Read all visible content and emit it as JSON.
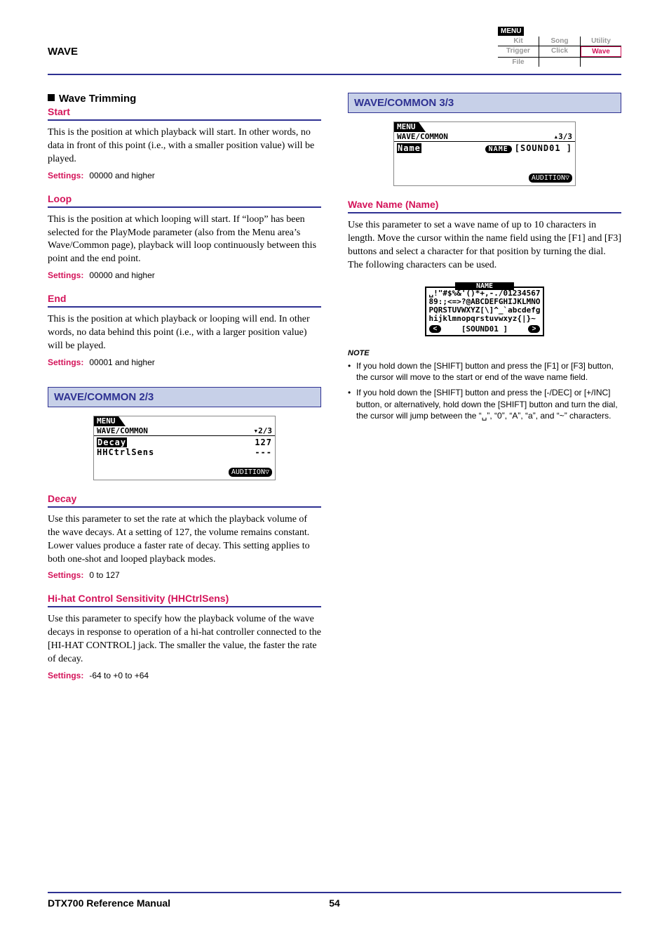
{
  "header": {
    "section": "WAVE",
    "menu_label": "MENU",
    "menu_cells": [
      [
        "Kit",
        "Song",
        "Utility"
      ],
      [
        "Trigger",
        "Click",
        "Wave"
      ],
      [
        "File",
        "",
        ""
      ]
    ],
    "active_cell": "Wave"
  },
  "left": {
    "trim_heading": "Wave Trimming",
    "start": {
      "title": "Start",
      "body": "This is the position at which playback will start. In other words, no data in front of this point (i.e., with a smaller position value) will be played.",
      "settings": "00000 and higher"
    },
    "loop": {
      "title": "Loop",
      "body": "This is the position at which looping will start. If “loop” has been selected for the PlayMode parameter (also from the Menu area’s Wave/Common page), playback will loop continuously between this point and the end point.",
      "settings": "00000 and higher"
    },
    "end": {
      "title": "End",
      "body": "This is the position at which playback or looping will end. In other words, no data behind this point (i.e., with a larger position value) will be played.",
      "settings": "00001 and higher"
    },
    "block23": "WAVE/COMMON 2/3",
    "lcd2": {
      "tab": "MENU",
      "path": "WAVE/COMMON",
      "page": "▾2/3",
      "rows": [
        [
          "Decay",
          "127"
        ],
        [
          "HHCtrlSens",
          "---"
        ]
      ],
      "audition": "AUDITION▽"
    },
    "decay": {
      "title": "Decay",
      "body": "Use this parameter to set the rate at which the playback volume of the wave decays. At a setting of 127, the volume remains constant. Lower values produce a faster rate of decay. This setting applies to both one-shot and looped playback modes.",
      "settings": "0 to 127"
    },
    "hhsens": {
      "title": "Hi-hat Control Sensitivity (HHCtrlSens)",
      "body": "Use this parameter to specify how the playback volume of the wave decays in response to operation of a hi-hat controller connected to the [HI-HAT CONTROL] jack. The smaller the value, the faster the rate of decay.",
      "settings": "-64 to +0 to +64"
    }
  },
  "right": {
    "block33": "WAVE/COMMON 3/3",
    "lcd3": {
      "tab": "MENU",
      "path": "WAVE/COMMON",
      "page": "▴3/3",
      "name_label": "Name",
      "name_btn": "NAME",
      "name_val": "[SOUND01   ]",
      "audition": "AUDITION▽"
    },
    "wavename": {
      "title": "Wave Name (Name)",
      "body": "Use this parameter to set a wave name of up to 10 characters in length. Move the cursor within the name field using the [F1] and [F3] buttons and select a character for that position by turning the dial. The following characters can be used."
    },
    "charpanel": {
      "header": "NAME",
      "lines": [
        "␣!\"#$%&'()*+,-./01234567",
        "89:;<=>?@ABCDEFGHIJKLMNO",
        "PQRSTUVWXYZ[\\]^_`abcdefg",
        "hijklmnopqrstuvwxyz{|}~"
      ],
      "value": "[SOUND01   ]"
    },
    "note_label": "NOTE",
    "notes": [
      "If you hold down the [SHIFT] button and press the [F1] or [F3] button, the cursor will move to the start or end of the wave name field.",
      "If you hold down the [SHIFT] button and press the [-/DEC] or [+/INC] button, or alternatively, hold down the [SHIFT] button and turn the dial, the cursor will jump between the “␣”, “0”, “A”, “a”, and “~” characters."
    ]
  },
  "labels": {
    "settings": "Settings:"
  },
  "footer": {
    "manual": "DTX700  Reference Manual",
    "page": "54"
  }
}
